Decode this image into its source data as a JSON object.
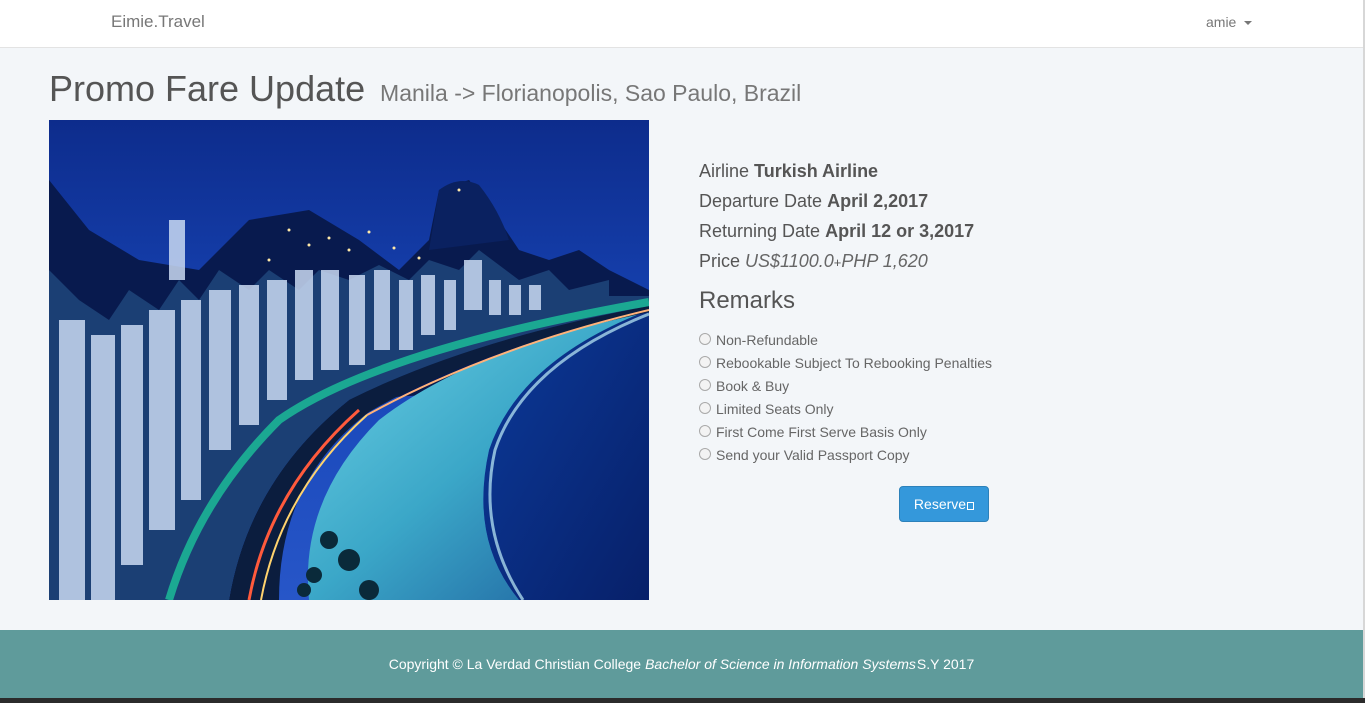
{
  "navbar": {
    "brand": "Eimie.Travel",
    "user": "amie"
  },
  "page": {
    "title": "Promo Fare Update",
    "route": "Manila -> Florianopolis, Sao Paulo, Brazil"
  },
  "details": {
    "airline_label": "Airline",
    "airline_value": "Turkish Airline",
    "departure_label": "Departure Date",
    "departure_value": "April 2,2017",
    "returning_label": "Returning Date",
    "returning_value": "April 12 or 3,2017",
    "price_label": "Price",
    "price_usd": "US$1100.0",
    "price_plus": "+",
    "price_php": "PHP 1,620"
  },
  "remarks": {
    "title": "Remarks",
    "items": [
      "Non-Refundable",
      "Rebookable Subject To Rebooking Penalties",
      "Book & Buy",
      "Limited Seats Only",
      "First Come First Serve Basis Only",
      "Send your Valid Passport Copy"
    ]
  },
  "reserve": {
    "label": "Reserve"
  },
  "footer": {
    "copyright": "Copyright © La Verdad Christian College",
    "program": "Bachelor of Science in Information Systems",
    "year": "S.Y 2017"
  },
  "colors": {
    "accent": "#3498db",
    "footer": "#5f9b9b",
    "background": "#f3f6f9"
  },
  "icons": {
    "user_menu": "caret-down-icon",
    "reserve": "unknown-glyph-icon"
  }
}
